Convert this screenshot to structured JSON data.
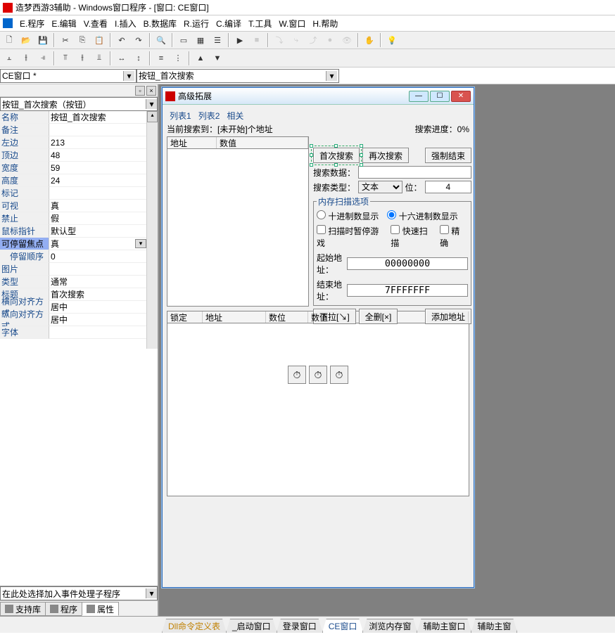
{
  "title": "造梦西游3辅助 - Windows窗口程序 - [窗口: CE窗口]",
  "menu": [
    "E.程序",
    "E.编辑",
    "V.查看",
    "I.插入",
    "B.数据库",
    "R.运行",
    "C.编译",
    "T.工具",
    "W.窗口",
    "H.帮助"
  ],
  "combo1": "CE窗口 *",
  "combo2": "按钮_首次搜索",
  "prop_combo": "按钮_首次搜索（按钮）",
  "props": [
    {
      "n": "名称",
      "v": "按钮_首次搜索"
    },
    {
      "n": "备注",
      "v": ""
    },
    {
      "n": "左边",
      "v": "213"
    },
    {
      "n": "顶边",
      "v": "48"
    },
    {
      "n": "宽度",
      "v": "59"
    },
    {
      "n": "高度",
      "v": "24"
    },
    {
      "n": "标记",
      "v": ""
    },
    {
      "n": "可视",
      "v": "真"
    },
    {
      "n": "禁止",
      "v": "假"
    },
    {
      "n": "鼠标指针",
      "v": "默认型"
    },
    {
      "n": "可停留焦点",
      "v": "真",
      "sel": true,
      "dd": true
    },
    {
      "n": "停留顺序",
      "v": "0",
      "indent": true
    },
    {
      "n": "图片",
      "v": ""
    },
    {
      "n": "类型",
      "v": "通常"
    },
    {
      "n": "标题",
      "v": "首次搜索"
    },
    {
      "n": "横向对齐方式",
      "v": "居中"
    },
    {
      "n": "纵向对齐方式",
      "v": "居中"
    },
    {
      "n": "字体",
      "v": ""
    }
  ],
  "event_label": "在此处选择加入事件处理子程序",
  "left_tabs": [
    "支持库",
    "程序",
    "属性"
  ],
  "child_window": {
    "title": "高级拓展",
    "tabs": [
      "列表1",
      "列表2",
      "相关"
    ],
    "status_left": "当前搜索到：[未开始]个地址",
    "status_right": "搜索进度：0%",
    "list_cols": [
      "地址",
      "数值"
    ],
    "btn_first": "首次搜索",
    "btn_again": "再次搜索",
    "btn_force": "强制结束",
    "lbl_search_data": "搜索数据：",
    "lbl_search_type": "搜索类型：",
    "type_value": "文本",
    "lbl_bits": "位：",
    "bits_value": "4",
    "group_title": "内存扫描选项",
    "radio_dec": "十进制数显示",
    "radio_hex": "十六进制数显示",
    "chk_pause": "扫描时暂停游戏",
    "chk_fast": "快速扫描",
    "chk_exact": "精确",
    "lbl_start": "起始地址：",
    "start_value": "00000000",
    "lbl_end": "结束地址：",
    "end_value": "7FFFFFFF",
    "btn_pull": "下拉[↘]",
    "btn_delall": "全删[×]",
    "btn_addaddr": "添加地址",
    "lower_cols": [
      "锁定",
      "地址",
      "数位",
      "数值"
    ]
  },
  "footer_tabs": [
    "Dll命令定义表",
    "_启动窗口",
    "登录窗口",
    "CE窗口",
    "浏览内存窗",
    "辅助主窗口",
    "辅助主窗"
  ]
}
